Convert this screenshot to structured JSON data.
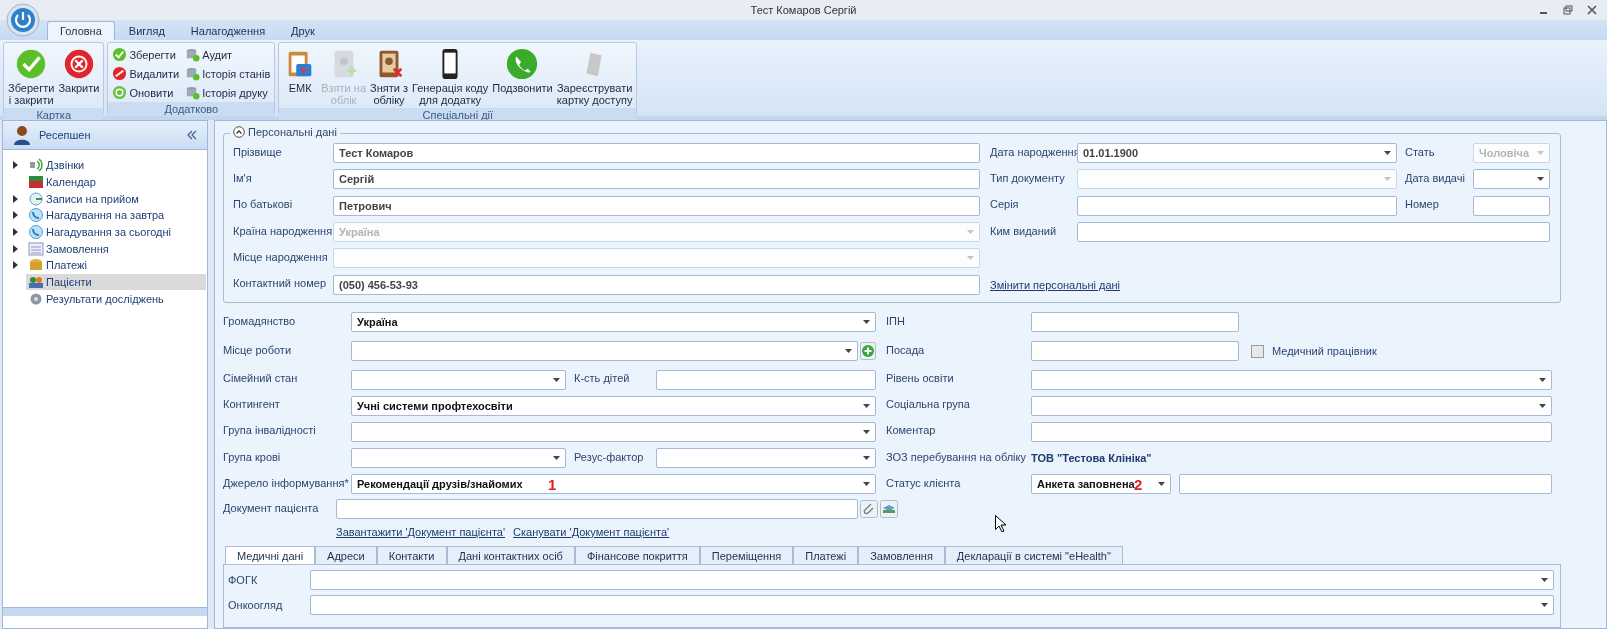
{
  "window": {
    "title": "Тест Комаров Сергій"
  },
  "ribbon_tabs": [
    {
      "label": "Головна",
      "selected": true
    },
    {
      "label": "Вигляд",
      "selected": false
    },
    {
      "label": "Налагодження",
      "selected": false
    },
    {
      "label": "Друк",
      "selected": false
    }
  ],
  "ribbon_groups": [
    {
      "title": "Картка",
      "kind": "large",
      "buttons": [
        {
          "label": "Зберегти\nі закрити",
          "disabled": false
        },
        {
          "label": "Закрити",
          "disabled": false
        }
      ]
    },
    {
      "title": "Додатково",
      "kind": "small",
      "buttons": [
        {
          "label": "Зберегти",
          "disabled": false
        },
        {
          "label": "Видалити",
          "disabled": false
        },
        {
          "label": "Оновити",
          "disabled": false
        },
        {
          "label": "Аудит",
          "disabled": false
        },
        {
          "label": "Історія станів",
          "disabled": false
        },
        {
          "label": "Історія друку",
          "disabled": false
        }
      ]
    },
    {
      "title": "Спеціальні дії",
      "kind": "large",
      "buttons": [
        {
          "label": "ЕМК",
          "disabled": false
        },
        {
          "label": "Взяти на\nоблік",
          "disabled": true
        },
        {
          "label": "Зняти з\nобліку",
          "disabled": false
        },
        {
          "label": "Генерація коду\nдля додатку",
          "disabled": false
        },
        {
          "label": "Подзвонити",
          "disabled": false
        },
        {
          "label": "Зареєструвати\nкартку доступу",
          "disabled": false
        }
      ]
    }
  ],
  "sidebar": {
    "title": "Ресепшен",
    "items": [
      {
        "label": "Дзвінки",
        "has_children": true,
        "selected": false
      },
      {
        "label": "Календар",
        "has_children": false,
        "selected": false
      },
      {
        "label": "Записи на прийом",
        "has_children": true,
        "selected": false
      },
      {
        "label": "Нагадування на завтра",
        "has_children": true,
        "selected": false
      },
      {
        "label": "Нагадування за сьогодні",
        "has_children": true,
        "selected": false
      },
      {
        "label": "Замовлення",
        "has_children": true,
        "selected": false
      },
      {
        "label": "Платежі",
        "has_children": true,
        "selected": false
      },
      {
        "label": "Пацієнти",
        "has_children": false,
        "selected": true
      },
      {
        "label": "Результати досліджень",
        "has_children": false,
        "selected": false
      }
    ]
  },
  "personal": {
    "title": "Персональні дані",
    "expanded": true,
    "fields": [
      {
        "label": "Прізвище",
        "kind": "text",
        "value": "Тест Комаров"
      },
      {
        "label": "Дата народження",
        "kind": "combo",
        "value": "01.01.1900",
        "disabled": false
      },
      {
        "label": "Стать",
        "kind": "combo",
        "value": "Чоловіча",
        "disabled": true
      },
      {
        "label": "Ім'я",
        "kind": "text",
        "value": "Сергій"
      },
      {
        "label": "Тип документу",
        "kind": "combo",
        "disabled": true
      },
      {
        "label": "Дата видачі",
        "kind": "combo",
        "disabled": false
      },
      {
        "label": "По батькові",
        "kind": "text",
        "value": "Петрович"
      },
      {
        "label": "Серія",
        "kind": "text"
      },
      {
        "label": "Номер",
        "kind": "text"
      },
      {
        "label": "Країна народження",
        "kind": "combo",
        "value": "Україна",
        "disabled": true
      },
      {
        "label": "Ким виданий",
        "kind": "text"
      },
      {
        "label": "Місце народження",
        "kind": "combo",
        "disabled": true
      },
      {
        "label": "Контактний номер",
        "kind": "text",
        "value": "(050) 456-53-93"
      },
      {
        "kind": "link",
        "text": "Змінити персональні дані"
      }
    ]
  },
  "details": [
    {
      "label": "Громадянство",
      "kind": "combo",
      "value": "Україна"
    },
    {
      "label": "ІПН",
      "kind": "text"
    },
    {
      "label": "Місце роботи",
      "kind": "combo-add"
    },
    {
      "label": "Посада",
      "kind": "text"
    },
    {
      "label": "Медичний працівник",
      "kind": "check",
      "checked": false
    },
    {
      "label": "Сімейний стан",
      "kind": "combo"
    },
    {
      "label": "К-сть дітей",
      "kind": "text"
    },
    {
      "label": "Рівень освіти",
      "kind": "combo"
    },
    {
      "label": "Контингент",
      "kind": "combo",
      "value": "Учні системи профтехосвіти"
    },
    {
      "label": "Соціальна група",
      "kind": "combo"
    },
    {
      "label": "Група інвалідності",
      "kind": "combo"
    },
    {
      "label": "Коментар",
      "kind": "text"
    },
    {
      "label": "Група крові",
      "kind": "combo"
    },
    {
      "label": "Резус-фактор",
      "kind": "combo"
    },
    {
      "label": "ЗОЗ перебування на обліку",
      "kind": "static",
      "value": "ТОВ \"Тестова Клініка\""
    },
    {
      "label": "Джерело інформування*",
      "kind": "combo",
      "value": "Рекомендації друзів/знайомих",
      "marker": "1"
    },
    {
      "label": "Статус клієнта",
      "kind": "status",
      "value": "Анкета заповнена",
      "marker": "2"
    },
    {
      "label": "Документ пацієнта",
      "kind": "document"
    },
    {
      "kind": "links",
      "links": [
        "Завантажити 'Документ пацієнта'",
        "Сканувати 'Документ пацієнта'"
      ]
    }
  ],
  "tabs": [
    {
      "label": "Медичні дані",
      "selected": true
    },
    {
      "label": "Адреси",
      "selected": false
    },
    {
      "label": "Контакти",
      "selected": false
    },
    {
      "label": "Дані контактних осіб",
      "selected": false
    },
    {
      "label": "Фінансове покриття",
      "selected": false
    },
    {
      "label": "Переміщення",
      "selected": false
    },
    {
      "label": "Платежі",
      "selected": false
    },
    {
      "label": "Замовлення",
      "selected": false
    },
    {
      "label": "Декларації в системі \"eHealth\"",
      "selected": false
    }
  ],
  "medical": [
    {
      "label": "ФОГК",
      "kind": "combo"
    },
    {
      "label": "Онкоогляд",
      "kind": "combo"
    }
  ]
}
